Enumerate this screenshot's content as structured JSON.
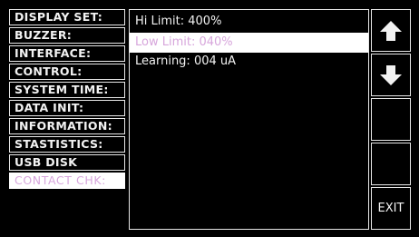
{
  "menu": {
    "items": [
      {
        "label": "DISPLAY SET:"
      },
      {
        "label": "BUZZER:"
      },
      {
        "label": "INTERFACE:"
      },
      {
        "label": "CONTROL:"
      },
      {
        "label": "SYSTEM TIME:"
      },
      {
        "label": "DATA INIT:"
      },
      {
        "label": "INFORMATION:"
      },
      {
        "label": "STASTISTICS:"
      },
      {
        "label": "USB DISK"
      },
      {
        "label": "CONTACT CHK:"
      }
    ],
    "selected": "CONTACT CHK:"
  },
  "content": {
    "rows": [
      {
        "text": "Hi Limit: 400%"
      },
      {
        "text": "Low Limit: 040%"
      },
      {
        "text": "Learning: 004 uA"
      }
    ],
    "selected": "Low Limit: 040%"
  },
  "side_buttons": {
    "up_icon": "arrow-up-icon",
    "down_icon": "arrow-down-icon",
    "exit_label": "EXIT"
  },
  "colors": {
    "background": "#000000",
    "border": "#e8e8e8",
    "text": "#f2f2f2",
    "highlight_background": "#ffffff",
    "highlight_text": "#d7a6dc"
  }
}
